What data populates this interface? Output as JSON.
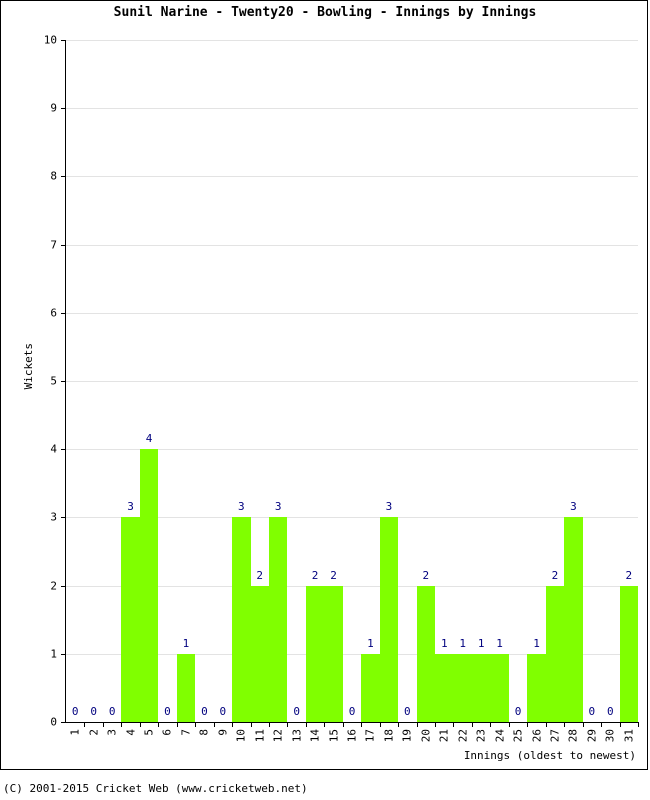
{
  "chart": {
    "title": "Sunil Narine - Twenty20 - Bowling - Innings by Innings",
    "y_axis_title": "Wickets",
    "x_axis_title": "Innings (oldest to newest)",
    "bar_color": "#80ff00",
    "label_color": "#00007f",
    "grid_color": "#e3e3e3",
    "axis_color": "#000000"
  },
  "footer": {
    "copyright": "(C) 2001-2015 Cricket Web (www.cricketweb.net)"
  },
  "chart_data": {
    "type": "bar",
    "title": "Sunil Narine - Twenty20 - Bowling - Innings by Innings",
    "xlabel": "Innings (oldest to newest)",
    "ylabel": "Wickets",
    "ylim": [
      0,
      10
    ],
    "yticks": [
      0,
      1,
      2,
      3,
      4,
      5,
      6,
      7,
      8,
      9,
      10
    ],
    "grid": true,
    "legend": null,
    "categories": [
      "1",
      "2",
      "3",
      "4",
      "5",
      "6",
      "7",
      "8",
      "9",
      "10",
      "11",
      "12",
      "13",
      "14",
      "15",
      "16",
      "17",
      "18",
      "19",
      "20",
      "21",
      "22",
      "23",
      "24",
      "25",
      "26",
      "27",
      "28",
      "29",
      "30",
      "31"
    ],
    "values": [
      0,
      0,
      0,
      3,
      4,
      0,
      1,
      0,
      0,
      3,
      2,
      3,
      0,
      2,
      2,
      0,
      1,
      3,
      0,
      2,
      1,
      1,
      1,
      1,
      0,
      1,
      2,
      3,
      0,
      0,
      2
    ],
    "data_labels": [
      "0",
      "0",
      "0",
      "3",
      "4",
      "0",
      "1",
      "0",
      "0",
      "3",
      "2",
      "3",
      "0",
      "2",
      "2",
      "0",
      "1",
      "3",
      "0",
      "2",
      "1",
      "1",
      "1",
      "1",
      "0",
      "1",
      "2",
      "3",
      "0",
      "0",
      "2"
    ]
  }
}
